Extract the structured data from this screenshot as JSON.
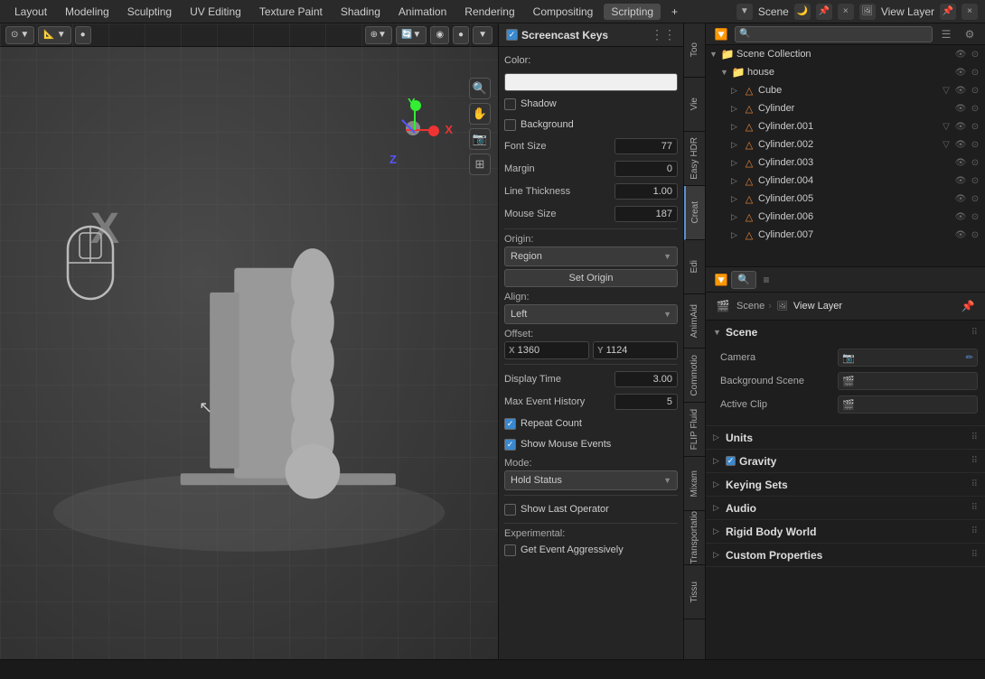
{
  "topMenu": {
    "items": [
      "Layout",
      "Modeling",
      "Sculpting",
      "UV Editing",
      "Texture Paint",
      "Shading",
      "Animation",
      "Rendering",
      "Compositing",
      "Scripting"
    ],
    "activeItem": "Scripting",
    "plusBtn": "+",
    "sceneLabel": "Scene",
    "viewLayerLabel": "View Layer"
  },
  "outliner": {
    "title": "Scene Collection",
    "searchPlaceholder": "Search...",
    "items": [
      {
        "id": "scene-collection",
        "label": "Scene Collection",
        "indent": 0,
        "type": "collection",
        "collapsed": false
      },
      {
        "id": "house",
        "label": "house",
        "indent": 1,
        "type": "collection",
        "collapsed": false
      },
      {
        "id": "cube",
        "label": "Cube",
        "indent": 2,
        "type": "mesh",
        "hasFilter": true
      },
      {
        "id": "cylinder",
        "label": "Cylinder",
        "indent": 2,
        "type": "mesh",
        "hasFilter": false
      },
      {
        "id": "cylinder001",
        "label": "Cylinder.001",
        "indent": 2,
        "type": "mesh",
        "hasFilter": true
      },
      {
        "id": "cylinder002",
        "label": "Cylinder.002",
        "indent": 2,
        "type": "mesh",
        "hasFilter": true
      },
      {
        "id": "cylinder003",
        "label": "Cylinder.003",
        "indent": 2,
        "type": "mesh",
        "hasFilter": false
      },
      {
        "id": "cylinder004",
        "label": "Cylinder.004",
        "indent": 2,
        "type": "mesh",
        "hasFilter": false
      },
      {
        "id": "cylinder005",
        "label": "Cylinder.005",
        "indent": 2,
        "type": "mesh",
        "hasFilter": false
      },
      {
        "id": "cylinder006",
        "label": "Cylinder.006",
        "indent": 2,
        "type": "mesh",
        "hasFilter": false
      },
      {
        "id": "cylinder007",
        "label": "Cylinder.007",
        "indent": 2,
        "type": "mesh",
        "hasFilter": false
      }
    ]
  },
  "breadcrumb": {
    "scene": "Scene",
    "viewLayer": "View Layer"
  },
  "sceneSection": {
    "title": "Scene",
    "fields": [
      {
        "label": "Camera",
        "value": "",
        "icon": "📷"
      },
      {
        "label": "Background Scene",
        "value": "",
        "icon": "🎬"
      },
      {
        "label": "Active Clip",
        "value": "",
        "icon": "🎬"
      }
    ]
  },
  "collapsedSections": [
    {
      "id": "units",
      "title": "Units"
    },
    {
      "id": "gravity",
      "title": "Gravity",
      "hasCheck": true,
      "checked": true
    },
    {
      "id": "keying-sets",
      "title": "Keying Sets"
    },
    {
      "id": "audio",
      "title": "Audio"
    },
    {
      "id": "rigid-body-world",
      "title": "Rigid Body World"
    },
    {
      "id": "custom-properties",
      "title": "Custom Properties"
    }
  ],
  "screencastPanel": {
    "title": "Screencast Keys",
    "checked": true,
    "colorLabel": "Color:",
    "fields": [
      {
        "id": "font-size",
        "label": "Font Size",
        "value": "77"
      },
      {
        "id": "margin",
        "label": "Margin",
        "value": "0"
      },
      {
        "id": "line-thickness",
        "label": "Line Thickness",
        "value": "1.00"
      },
      {
        "id": "mouse-size",
        "label": "Mouse Size",
        "value": "187"
      }
    ],
    "originLabel": "Origin:",
    "originValue": "Region",
    "setOriginBtn": "Set Origin",
    "alignLabel": "Align:",
    "alignValue": "Left",
    "offsetLabel": "Offset:",
    "offsetX": {
      "axis": "X",
      "value": "1360"
    },
    "offsetY": {
      "axis": "Y",
      "value": "1124"
    },
    "displayTimeLabel": "Display Time",
    "displayTimeValue": "3.00",
    "maxEventHistoryLabel": "Max Event History",
    "maxEventHistoryValue": "5",
    "repeatCountLabel": "Repeat Count",
    "repeatCountChecked": true,
    "showMouseEventsLabel": "Show Mouse Events",
    "showMouseEventsChecked": true,
    "modeLabel": "Mode:",
    "modeValue": "Hold Status",
    "showLastOperatorLabel": "Show Last Operator",
    "showLastOperatorChecked": false,
    "experimentalLabel": "Experimental:",
    "getEventAggressivelyLabel": "Get Event Aggressively",
    "getEventAggressivelyChecked": false
  },
  "verticalTabs": [
    {
      "id": "too",
      "label": "Too"
    },
    {
      "id": "vie",
      "label": "Vie"
    },
    {
      "id": "easy-hdr",
      "label": "Easy HDR"
    },
    {
      "id": "creat",
      "label": "Creat"
    },
    {
      "id": "edi",
      "label": "Edi"
    },
    {
      "id": "animaid",
      "label": "AnimAid"
    },
    {
      "id": "commotio",
      "label": "Commotio"
    },
    {
      "id": "flip-fluid",
      "label": "FLIP Fluid"
    },
    {
      "id": "mixam",
      "label": "Mixam"
    },
    {
      "id": "transportation",
      "label": "Transportatio"
    },
    {
      "id": "tissu",
      "label": "Tissu"
    }
  ],
  "statusBar": {
    "text": ""
  }
}
